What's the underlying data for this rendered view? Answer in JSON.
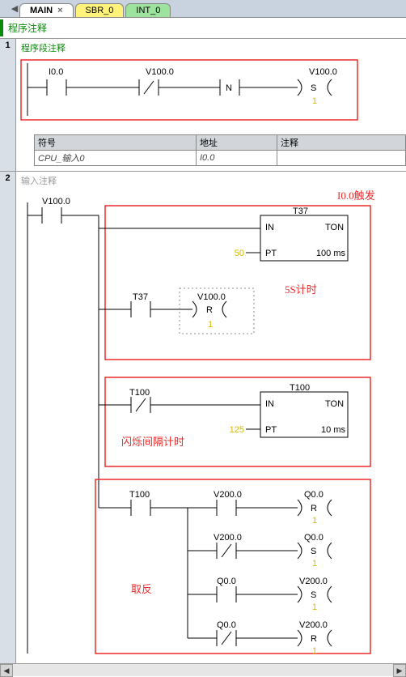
{
  "tabs": [
    {
      "label": "MAIN",
      "kind": "active"
    },
    {
      "label": "SBR_0",
      "kind": "yellow"
    },
    {
      "label": "INT_0",
      "kind": "green"
    }
  ],
  "program_comment_label": "程序注释",
  "networks": [
    {
      "num": "1",
      "seg_comment": "程序段注释",
      "rung1": {
        "contact1": "I0.0",
        "contact2": "V100.0",
        "contact2_is_nc": true,
        "mid": "N",
        "coil": "V100.0",
        "coil_op": "S",
        "coil_cnt": "1"
      },
      "sym_header": {
        "c1": "符号",
        "c2": "地址",
        "c3": "注释"
      },
      "sym_row": {
        "c1": "CPU_输入0",
        "c2": "I0.0",
        "c3": ""
      },
      "callout": "I0.0触发"
    },
    {
      "num": "2",
      "seg_comment": "输入注释",
      "main_contact": "V100.0",
      "block_a": {
        "timer": "T37",
        "type": "TON",
        "in_label": "IN",
        "pt_val": "50",
        "pt_label": "PT",
        "res": "100 ms",
        "annot": "5S计时",
        "branch_contact": "T37",
        "branch_coil": "V100.0",
        "branch_op": "R",
        "branch_cnt": "1"
      },
      "block_b": {
        "contact": "T100",
        "contact_nc": true,
        "timer": "T100",
        "type": "TON",
        "in_label": "IN",
        "pt_val": "125",
        "pt_label": "PT",
        "res": "10 ms",
        "annot": "闪烁间隔计时"
      },
      "block_c": {
        "annot": "取反",
        "contact": "T100",
        "rows": [
          {
            "c": "V200.0",
            "nc": false,
            "coil": "Q0.0",
            "op": "R",
            "cnt": "1"
          },
          {
            "c": "V200.0",
            "nc": true,
            "coil": "Q0.0",
            "op": "S",
            "cnt": "1"
          },
          {
            "c": "Q0.0",
            "nc": false,
            "coil": "V200.0",
            "op": "S",
            "cnt": "1"
          },
          {
            "c": "Q0.0",
            "nc": true,
            "coil": "V200.0",
            "op": "R",
            "cnt": "1"
          }
        ]
      }
    }
  ]
}
